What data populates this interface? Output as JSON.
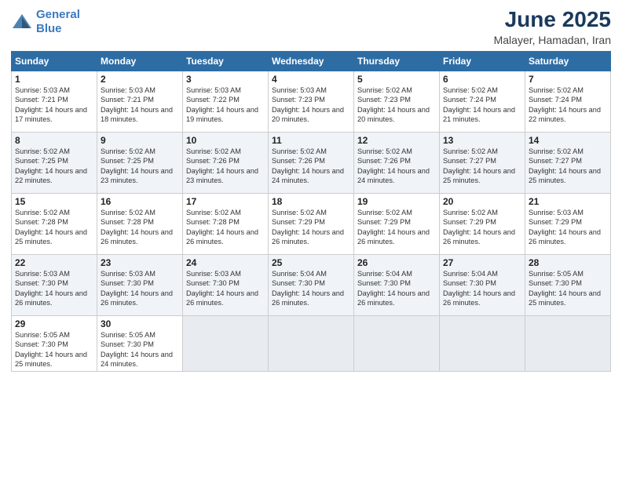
{
  "header": {
    "logo_line1": "General",
    "logo_line2": "Blue",
    "month": "June 2025",
    "location": "Malayer, Hamadan, Iran"
  },
  "weekdays": [
    "Sunday",
    "Monday",
    "Tuesday",
    "Wednesday",
    "Thursday",
    "Friday",
    "Saturday"
  ],
  "weeks": [
    [
      {
        "day": "1",
        "sunrise": "5:03 AM",
        "sunset": "7:21 PM",
        "daylight": "14 hours and 17 minutes."
      },
      {
        "day": "2",
        "sunrise": "5:03 AM",
        "sunset": "7:21 PM",
        "daylight": "14 hours and 18 minutes."
      },
      {
        "day": "3",
        "sunrise": "5:03 AM",
        "sunset": "7:22 PM",
        "daylight": "14 hours and 19 minutes."
      },
      {
        "day": "4",
        "sunrise": "5:03 AM",
        "sunset": "7:23 PM",
        "daylight": "14 hours and 20 minutes."
      },
      {
        "day": "5",
        "sunrise": "5:02 AM",
        "sunset": "7:23 PM",
        "daylight": "14 hours and 20 minutes."
      },
      {
        "day": "6",
        "sunrise": "5:02 AM",
        "sunset": "7:24 PM",
        "daylight": "14 hours and 21 minutes."
      },
      {
        "day": "7",
        "sunrise": "5:02 AM",
        "sunset": "7:24 PM",
        "daylight": "14 hours and 22 minutes."
      }
    ],
    [
      {
        "day": "8",
        "sunrise": "5:02 AM",
        "sunset": "7:25 PM",
        "daylight": "14 hours and 22 minutes."
      },
      {
        "day": "9",
        "sunrise": "5:02 AM",
        "sunset": "7:25 PM",
        "daylight": "14 hours and 23 minutes."
      },
      {
        "day": "10",
        "sunrise": "5:02 AM",
        "sunset": "7:26 PM",
        "daylight": "14 hours and 23 minutes."
      },
      {
        "day": "11",
        "sunrise": "5:02 AM",
        "sunset": "7:26 PM",
        "daylight": "14 hours and 24 minutes."
      },
      {
        "day": "12",
        "sunrise": "5:02 AM",
        "sunset": "7:26 PM",
        "daylight": "14 hours and 24 minutes."
      },
      {
        "day": "13",
        "sunrise": "5:02 AM",
        "sunset": "7:27 PM",
        "daylight": "14 hours and 25 minutes."
      },
      {
        "day": "14",
        "sunrise": "5:02 AM",
        "sunset": "7:27 PM",
        "daylight": "14 hours and 25 minutes."
      }
    ],
    [
      {
        "day": "15",
        "sunrise": "5:02 AM",
        "sunset": "7:28 PM",
        "daylight": "14 hours and 25 minutes."
      },
      {
        "day": "16",
        "sunrise": "5:02 AM",
        "sunset": "7:28 PM",
        "daylight": "14 hours and 26 minutes."
      },
      {
        "day": "17",
        "sunrise": "5:02 AM",
        "sunset": "7:28 PM",
        "daylight": "14 hours and 26 minutes."
      },
      {
        "day": "18",
        "sunrise": "5:02 AM",
        "sunset": "7:29 PM",
        "daylight": "14 hours and 26 minutes."
      },
      {
        "day": "19",
        "sunrise": "5:02 AM",
        "sunset": "7:29 PM",
        "daylight": "14 hours and 26 minutes."
      },
      {
        "day": "20",
        "sunrise": "5:02 AM",
        "sunset": "7:29 PM",
        "daylight": "14 hours and 26 minutes."
      },
      {
        "day": "21",
        "sunrise": "5:03 AM",
        "sunset": "7:29 PM",
        "daylight": "14 hours and 26 minutes."
      }
    ],
    [
      {
        "day": "22",
        "sunrise": "5:03 AM",
        "sunset": "7:30 PM",
        "daylight": "14 hours and 26 minutes."
      },
      {
        "day": "23",
        "sunrise": "5:03 AM",
        "sunset": "7:30 PM",
        "daylight": "14 hours and 26 minutes."
      },
      {
        "day": "24",
        "sunrise": "5:03 AM",
        "sunset": "7:30 PM",
        "daylight": "14 hours and 26 minutes."
      },
      {
        "day": "25",
        "sunrise": "5:04 AM",
        "sunset": "7:30 PM",
        "daylight": "14 hours and 26 minutes."
      },
      {
        "day": "26",
        "sunrise": "5:04 AM",
        "sunset": "7:30 PM",
        "daylight": "14 hours and 26 minutes."
      },
      {
        "day": "27",
        "sunrise": "5:04 AM",
        "sunset": "7:30 PM",
        "daylight": "14 hours and 26 minutes."
      },
      {
        "day": "28",
        "sunrise": "5:05 AM",
        "sunset": "7:30 PM",
        "daylight": "14 hours and 25 minutes."
      }
    ],
    [
      {
        "day": "29",
        "sunrise": "5:05 AM",
        "sunset": "7:30 PM",
        "daylight": "14 hours and 25 minutes."
      },
      {
        "day": "30",
        "sunrise": "5:05 AM",
        "sunset": "7:30 PM",
        "daylight": "14 hours and 24 minutes."
      },
      null,
      null,
      null,
      null,
      null
    ]
  ]
}
